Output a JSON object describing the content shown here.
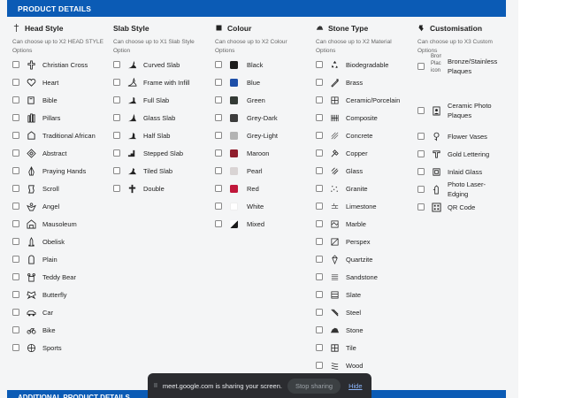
{
  "header": {
    "title": "PRODUCT DETAILS"
  },
  "footer": {
    "title": "ADDITIONAL PRODUCT DETAILS"
  },
  "columns": [
    {
      "title": "Head Style",
      "icon": "cross-icon",
      "subtitle": "Can choose up to X2 HEAD STYLE Options",
      "items": [
        {
          "label": "Christian Cross",
          "icon": "christian-cross-icon"
        },
        {
          "label": "Heart",
          "icon": "heart-icon"
        },
        {
          "label": "Bible",
          "icon": "bible-icon"
        },
        {
          "label": "Pillars",
          "icon": "pillars-icon"
        },
        {
          "label": "Traditional African",
          "icon": "african-shape-icon"
        },
        {
          "label": "Abstract",
          "icon": "abstract-icon"
        },
        {
          "label": "Praying Hands",
          "icon": "praying-hands-icon"
        },
        {
          "label": "Scroll",
          "icon": "scroll-icon"
        },
        {
          "label": "Angel",
          "icon": "angel-icon"
        },
        {
          "label": "Mausoleum",
          "icon": "mausoleum-icon"
        },
        {
          "label": "Obelisk",
          "icon": "obelisk-icon"
        },
        {
          "label": "Plain",
          "icon": "plain-icon"
        },
        {
          "label": "Teddy Bear",
          "icon": "teddy-bear-icon"
        },
        {
          "label": "Butterfly",
          "icon": "butterfly-icon"
        },
        {
          "label": "Car",
          "icon": "car-icon"
        },
        {
          "label": "Bike",
          "icon": "bike-icon"
        },
        {
          "label": "Sports",
          "icon": "sports-icon"
        }
      ]
    },
    {
      "title": "Slab Style",
      "icon": "",
      "subtitle": "Can choose up to X1 Slab Style Option",
      "items": [
        {
          "label": "Curved Slab",
          "icon": "curved-slab-icon"
        },
        {
          "label": "Frame with Infill",
          "icon": "frame-slab-icon"
        },
        {
          "label": "Full Slab",
          "icon": "full-slab-icon"
        },
        {
          "label": "Glass Slab",
          "icon": "glass-slab-icon"
        },
        {
          "label": "Half Slab",
          "icon": "half-slab-icon"
        },
        {
          "label": "Stepped Slab",
          "icon": "stepped-slab-icon"
        },
        {
          "label": "Tiled Slab",
          "icon": "tiled-slab-icon"
        },
        {
          "label": "Double",
          "icon": "double-slab-icon"
        }
      ]
    },
    {
      "title": "Colour",
      "icon": "square-icon",
      "subtitle": "Can choose up to X2 Colour Options",
      "items": [
        {
          "label": "Black",
          "color": "#1c1c1c"
        },
        {
          "label": "Blue",
          "color": "#1d4fa8"
        },
        {
          "label": "Green",
          "color": "#333a35"
        },
        {
          "label": "Grey-Dark",
          "color": "#3c3c3c"
        },
        {
          "label": "Grey-Light",
          "color": "#b3b3b3"
        },
        {
          "label": "Maroon",
          "color": "#8f1d2c"
        },
        {
          "label": "Pearl",
          "color": "#d9d4d4"
        },
        {
          "label": "Red",
          "color": "#c0173a"
        },
        {
          "label": "White",
          "color": "#ffffff"
        },
        {
          "label": "Mixed",
          "color": "mixed"
        }
      ]
    },
    {
      "title": "Stone Type",
      "icon": "stone-icon",
      "subtitle": "Can choose up to X2 Material Options",
      "items": [
        {
          "label": "Biodegradable",
          "icon": "recycle-icon"
        },
        {
          "label": "Brass",
          "icon": "brass-icon"
        },
        {
          "label": "Ceramic/Porcelain",
          "icon": "ceramic-icon"
        },
        {
          "label": "Composite",
          "icon": "composite-icon"
        },
        {
          "label": "Concrete",
          "icon": "concrete-icon"
        },
        {
          "label": "Copper",
          "icon": "copper-icon"
        },
        {
          "label": "Glass",
          "icon": "glass-icon"
        },
        {
          "label": "Granite",
          "icon": "granite-icon"
        },
        {
          "label": "Limestone",
          "icon": "limestone-icon"
        },
        {
          "label": "Marble",
          "icon": "marble-icon"
        },
        {
          "label": "Perspex",
          "icon": "perspex-icon"
        },
        {
          "label": "Quartzite",
          "icon": "quartzite-icon"
        },
        {
          "label": "Sandstone",
          "icon": "sandstone-icon"
        },
        {
          "label": "Slate",
          "icon": "slate-icon"
        },
        {
          "label": "Steel",
          "icon": "steel-icon"
        },
        {
          "label": "Stone",
          "icon": "stone-icon"
        },
        {
          "label": "Tile",
          "icon": "tile-icon"
        },
        {
          "label": "Wood",
          "icon": "wood-icon"
        }
      ]
    },
    {
      "title": "Customisation",
      "icon": "customisation-icon",
      "subtitle": "Can choose up to X3 Custom Options",
      "items": [
        {
          "label": "Bronze/Stainless Plaques",
          "icon": "broken-image-icon",
          "broken_alt": "Bronz Plac icon"
        },
        {
          "label": "Ceramic Photo Plaques",
          "icon": "photo-plaque-icon"
        },
        {
          "label": "Flower Vases",
          "icon": "flower-icon"
        },
        {
          "label": "Gold Lettering",
          "icon": "lettering-icon"
        },
        {
          "label": "Inlaid Glass",
          "icon": "inlaid-glass-icon"
        },
        {
          "label": "Photo Laser-Edging",
          "icon": "laser-edging-icon"
        },
        {
          "label": "QR Code",
          "icon": "qr-code-icon"
        }
      ]
    }
  ],
  "share_bar": {
    "pause": "II",
    "message": "meet.google.com is sharing your screen.",
    "stop_label": "Stop sharing",
    "hide_label": "Hide"
  }
}
